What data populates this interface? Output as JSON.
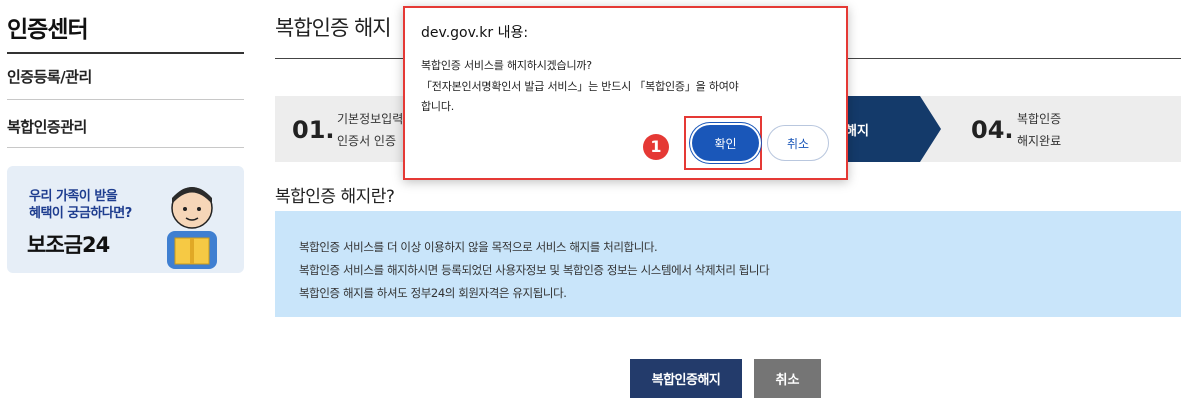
{
  "sidebar": {
    "title": "인증센터",
    "items": [
      {
        "label": "인증등록/관리"
      },
      {
        "label": "복합인증관리"
      }
    ],
    "banner": {
      "line1": "우리 가족이 받을",
      "line2": "혜택이 궁금하다면?",
      "brand": "보조금24"
    }
  },
  "main": {
    "title": "복합인증 해지",
    "steps": [
      {
        "num": "01.",
        "line1": "기본정보입력",
        "line2": "인증서 인증"
      },
      {
        "label": "해지"
      },
      {
        "num": "04.",
        "line1": "복합인증",
        "line2": "해지완료"
      }
    ],
    "section_title": "복합인증 해지란?",
    "info": [
      "복합인증 서비스를 더 이상 이용하지 않을 목적으로 서비스 해지를 처리합니다.",
      "복합인증 서비스를 해지하시면 등록되었던 사용자정보 및 복합인증 정보는 시스템에서 삭제처리 됩니다",
      "복합인증 해지를 하셔도 정부24의 회원자격은 유지됩니다."
    ],
    "buttons": {
      "primary": "복합인증해지",
      "cancel": "취소"
    }
  },
  "dialog": {
    "title": "dev.gov.kr 내용:",
    "message": [
      "복합인증 서비스를 해지하시겠습니까?",
      "「전자본인서명확인서 발급 서비스」는 반드시 「복합인증」을 하여야",
      "합니다."
    ],
    "ok_label": "확인",
    "cancel_label": "취소",
    "callout": "1"
  },
  "colors": {
    "navy": "#233b6b",
    "step_active": "#143a6a",
    "info_bg": "#c9e5fa",
    "annotation_red": "#e53935",
    "ok_blue": "#1a57b9"
  }
}
